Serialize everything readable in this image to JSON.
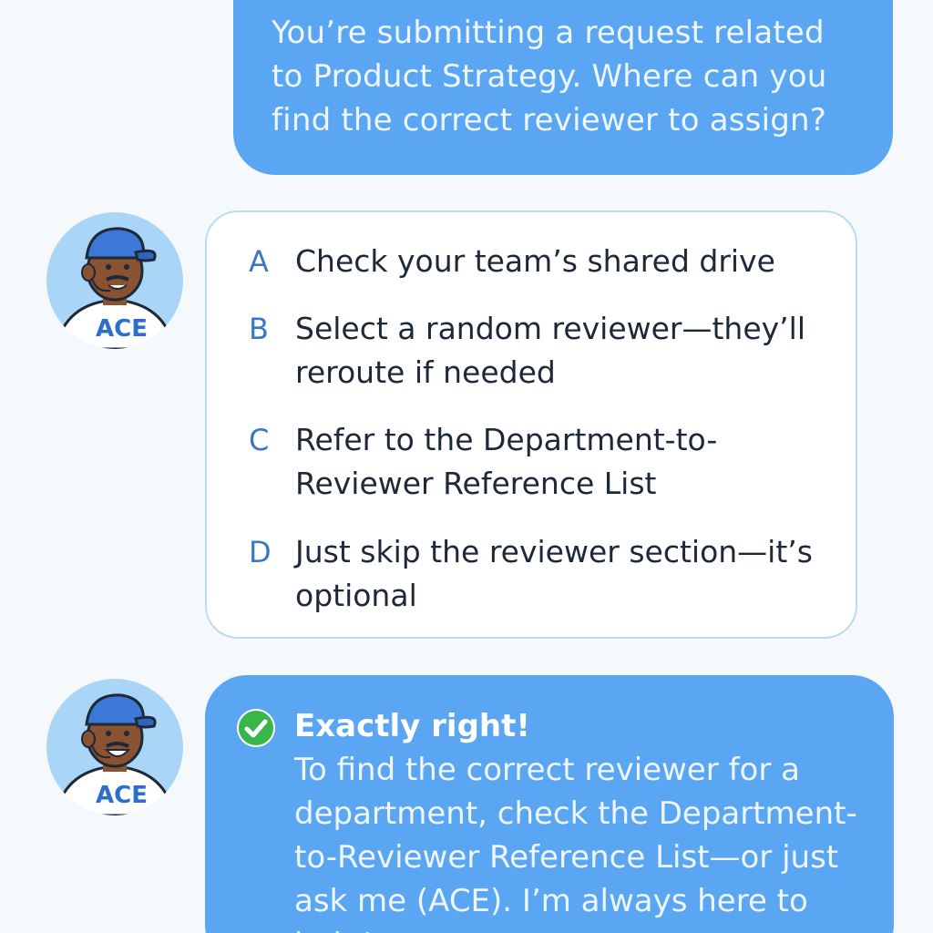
{
  "question": {
    "text": "You’re submitting a request related to Product Strategy. Where can you find the correct reviewer to assign?"
  },
  "avatars": [
    {
      "label": "ACE"
    },
    {
      "label": "ACE"
    }
  ],
  "options": [
    {
      "letter": "A",
      "text": "Check your team’s shared drive"
    },
    {
      "letter": "B",
      "text": "Select a random reviewer—they’ll reroute if needed"
    },
    {
      "letter": "C",
      "text": "Refer to the Department-to-Reviewer Reference List"
    },
    {
      "letter": "D",
      "text": "Just skip the reviewer section—it’s optional"
    }
  ],
  "feedback": {
    "title": "Exactly right!",
    "body": "To find the correct reviewer for a department, check the Department-to-Reviewer Reference List—or just ask me (ACE). I’m always here to help!"
  },
  "colors": {
    "bubble": "#5aa6f2",
    "card_border": "#b9dcf6",
    "letter": "#3b78c2",
    "text": "#1d2838",
    "check": "#3ab54a",
    "avatar_bg": "#a9d6f7"
  }
}
